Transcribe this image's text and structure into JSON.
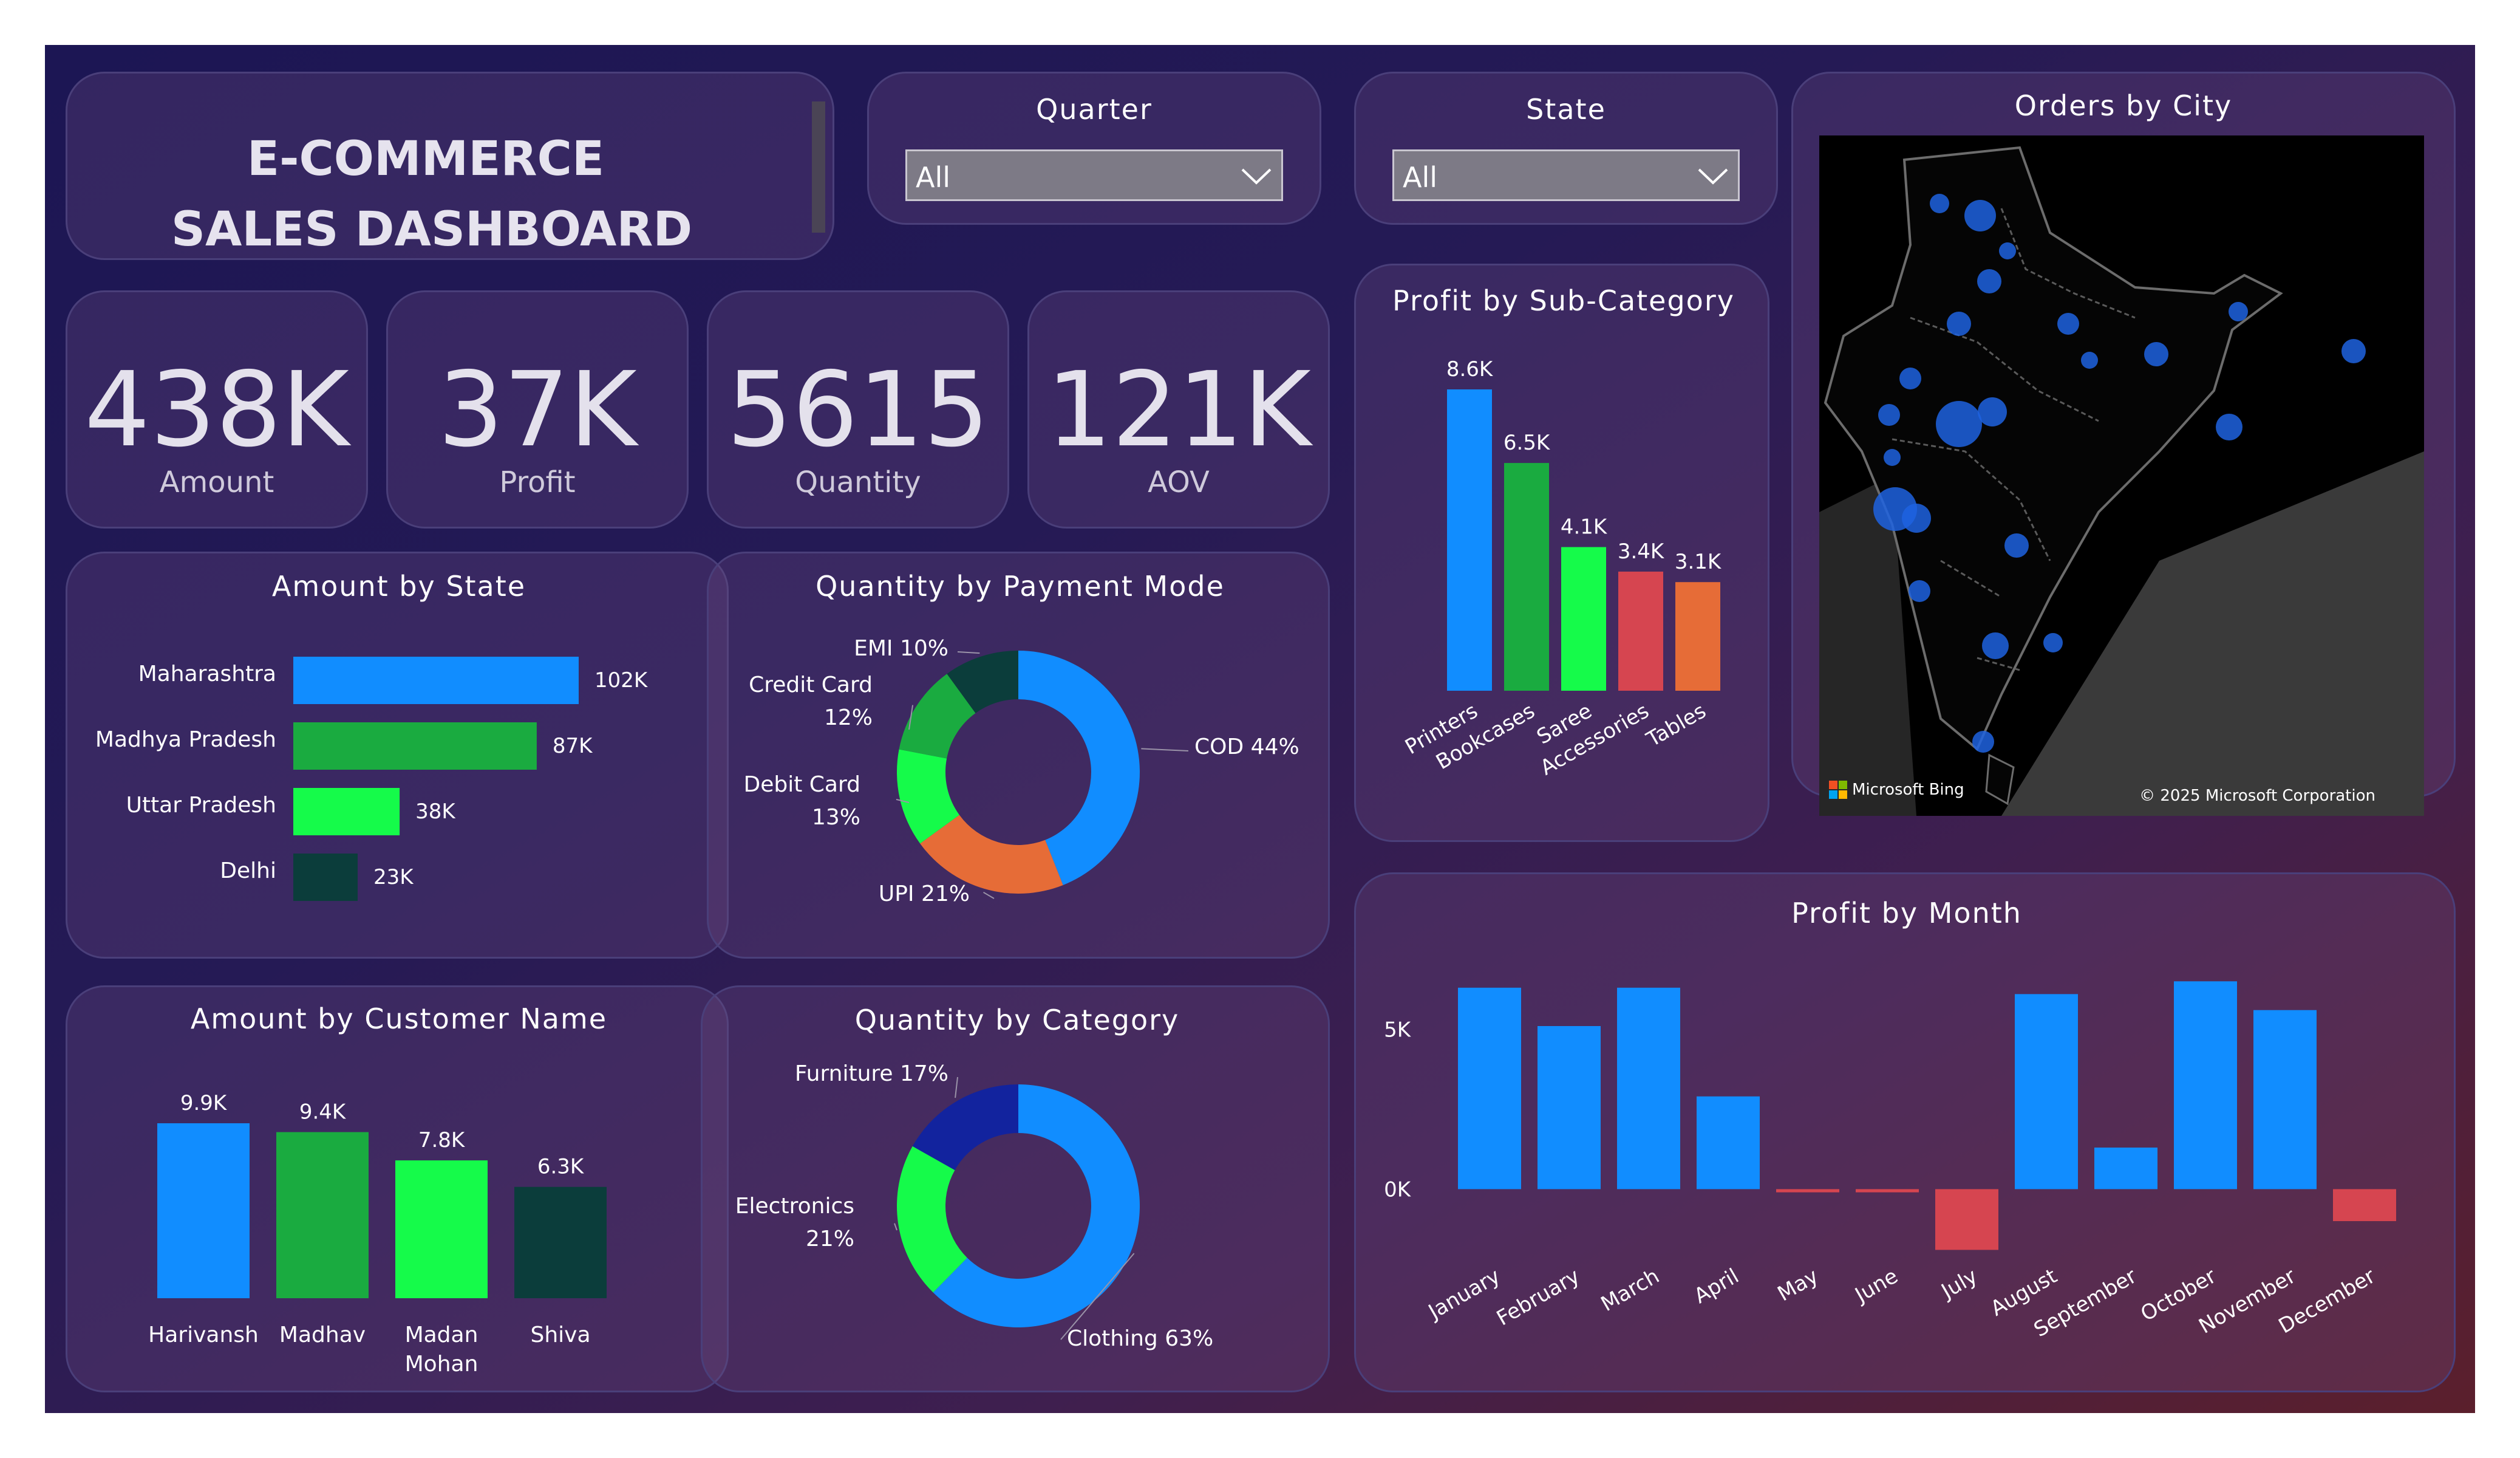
{
  "header": {
    "title_line1": "E-COMMERCE",
    "title_line2": "SALES DASHBOARD"
  },
  "slicers": [
    {
      "label": "Quarter",
      "value": "All"
    },
    {
      "label": "State",
      "value": "All"
    }
  ],
  "kpis": [
    {
      "value": "438K",
      "label": "Amount"
    },
    {
      "value": "37K",
      "label": "Profit"
    },
    {
      "value": "5615",
      "label": "Quantity"
    },
    {
      "value": "121K",
      "label": "AOV"
    }
  ],
  "map": {
    "title": "Orders by City",
    "attribution_left": "Microsoft Bing",
    "attribution_right": "© 2025 Microsoft Corporation"
  },
  "colors": {
    "blue": "#118dff",
    "green": "#1aab40",
    "lime": "#15fb4a",
    "red": "#d64550",
    "orange": "#e66c37",
    "darkteal": "#0b3d3b",
    "navy": "#12239e"
  },
  "chart_data": [
    {
      "id": "amount_by_state",
      "type": "bar",
      "orientation": "horizontal",
      "title": "Amount by State",
      "categories": [
        "Maharashtra",
        "Madhya Pradesh",
        "Uttar Pradesh",
        "Delhi"
      ],
      "values": [
        102,
        87,
        38,
        23
      ],
      "unit": "K",
      "labels": [
        "102K",
        "87K",
        "38K",
        "23K"
      ],
      "colors": [
        "#118dff",
        "#1aab40",
        "#15fb4a",
        "#0b3d3b"
      ]
    },
    {
      "id": "quantity_by_payment_mode",
      "type": "pie",
      "donut": true,
      "title": "Quantity by Payment Mode",
      "slices": [
        {
          "name": "COD",
          "value": 44,
          "label": "COD 44%",
          "color": "#118dff"
        },
        {
          "name": "UPI",
          "value": 21,
          "label": "UPI 21%",
          "color": "#e66c37"
        },
        {
          "name": "Debit Card",
          "value": 13,
          "label": "Debit Card 13%",
          "color": "#15fb4a"
        },
        {
          "name": "Credit Card",
          "value": 12,
          "label": "Credit Card 12%",
          "color": "#1aab40"
        },
        {
          "name": "EMI",
          "value": 10,
          "label": "EMI 10%",
          "color": "#0b3d3b"
        }
      ]
    },
    {
      "id": "profit_by_subcategory",
      "type": "bar",
      "title": "Profit by Sub-Category",
      "categories": [
        "Printers",
        "Bookcases",
        "Saree",
        "Accessories",
        "Tables"
      ],
      "values": [
        8.6,
        6.5,
        4.1,
        3.4,
        3.1
      ],
      "unit": "K",
      "labels": [
        "8.6K",
        "6.5K",
        "4.1K",
        "3.4K",
        "3.1K"
      ],
      "colors": [
        "#118dff",
        "#1aab40",
        "#15fb4a",
        "#d64550",
        "#e66c37"
      ]
    },
    {
      "id": "amount_by_customer",
      "type": "bar",
      "title": "Amount by Customer Name",
      "categories": [
        "Harivansh",
        "Madhav",
        "Madan Mohan",
        "Shiva"
      ],
      "values": [
        9.9,
        9.4,
        7.8,
        6.3
      ],
      "unit": "K",
      "labels": [
        "9.9K",
        "9.4K",
        "7.8K",
        "6.3K"
      ],
      "colors": [
        "#118dff",
        "#1aab40",
        "#15fb4a",
        "#0b3d3b"
      ]
    },
    {
      "id": "quantity_by_category",
      "type": "pie",
      "donut": true,
      "title": "Quantity by Category",
      "slices": [
        {
          "name": "Clothing",
          "value": 63,
          "label": "Clothing 63%",
          "color": "#118dff"
        },
        {
          "name": "Electronics",
          "value": 21,
          "label": "Electronics 21%",
          "color": "#15fb4a"
        },
        {
          "name": "Furniture",
          "value": 17,
          "label": "Furniture 17%",
          "color": "#12239e"
        }
      ]
    },
    {
      "id": "profit_by_month",
      "type": "bar",
      "title": "Profit by Month",
      "categories": [
        "January",
        "February",
        "March",
        "April",
        "May",
        "June",
        "July",
        "August",
        "September",
        "October",
        "November",
        "December"
      ],
      "values": [
        6.3,
        5.1,
        6.3,
        2.9,
        -0.1,
        -0.1,
        -1.9,
        6.1,
        1.3,
        6.5,
        5.6,
        -1.0
      ],
      "unit": "K",
      "yticks": [
        "0K",
        "5K"
      ],
      "ylim": [
        -2.5,
        7
      ],
      "colors": {
        "positive": "#118dff",
        "negative": "#d64550"
      }
    }
  ]
}
